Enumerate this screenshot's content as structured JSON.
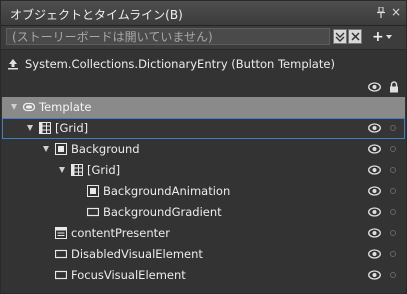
{
  "panel": {
    "title": "オブジェクトとタイムライン(B)",
    "close_glyph": "×",
    "search_placeholder": "(ストーリーボードは開いていません)",
    "add_glyph": "+"
  },
  "scope": {
    "label": "System.Collections.DictionaryEntry (Button Template)"
  },
  "tree": [
    {
      "label": "Template",
      "icon": "template-icon",
      "expanded": true
    },
    {
      "label": "[Grid]",
      "icon": "grid-icon",
      "expanded": true,
      "selected": true
    },
    {
      "label": "Background",
      "icon": "border-icon",
      "expanded": true
    },
    {
      "label": "[Grid]",
      "icon": "grid-icon",
      "expanded": true
    },
    {
      "label": "BackgroundAnimation",
      "icon": "border-icon"
    },
    {
      "label": "BackgroundGradient",
      "icon": "rectangle-icon"
    },
    {
      "label": "contentPresenter",
      "icon": "content-presenter-icon"
    },
    {
      "label": "DisabledVisualElement",
      "icon": "rectangle-icon"
    },
    {
      "label": "FocusVisualElement",
      "icon": "rectangle-icon"
    }
  ]
}
